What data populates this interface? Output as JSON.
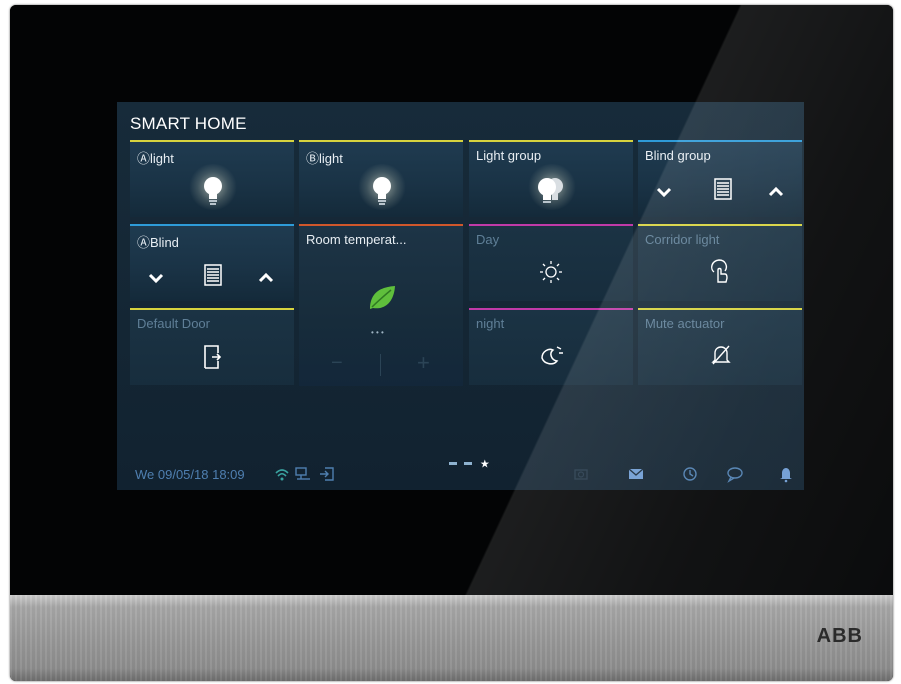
{
  "header": {
    "title": "SMART HOME"
  },
  "brand": {
    "logo_text": "ABB"
  },
  "tiles": [
    {
      "label": "Ⓐlight",
      "icon": "bulb-icon",
      "accent": "#d7d33e"
    },
    {
      "label": "Ⓑlight",
      "icon": "bulb-icon",
      "accent": "#d7d33e"
    },
    {
      "label": "Light group",
      "icon": "double-bulb-icon",
      "accent": "#d7d33e"
    },
    {
      "label": "Blind group",
      "icon": "blind-icon",
      "accent": "#2e9bd8"
    },
    {
      "label": "ⒶBlind",
      "icon": "blind-icon",
      "accent": "#2e9bd8"
    },
    {
      "label": "Room temperat...",
      "icon": "leaf-icon",
      "accent": "#d0572b",
      "minus": "−",
      "plus": "+",
      "dots": "• • •"
    },
    {
      "label": "Day",
      "icon": "sun-icon",
      "accent": "#c03aa8"
    },
    {
      "label": "Corridor light",
      "icon": "touch-bulb-icon",
      "accent": "#d7d33e"
    },
    {
      "label": "Default Door",
      "icon": "door-icon",
      "accent": "#d7d33e"
    },
    {
      "label": "night",
      "icon": "moon-icon",
      "accent": "#c03aa8"
    },
    {
      "label": "Mute actuator",
      "icon": "mute-bell-icon",
      "accent": "#d7d33e"
    }
  ],
  "status_bar": {
    "datetime": "We 09/05/18  18:09",
    "icons": [
      "wifi-icon",
      "network-icon",
      "logout-icon",
      "camera-icon",
      "mail-icon",
      "history-icon",
      "chat-icon",
      "bell-icon"
    ]
  },
  "colors": {
    "screen_bg": "#142634",
    "tile_bg": "#1d374b",
    "yellow": "#d7d33e",
    "blue": "#2e9bd8",
    "orange": "#d0572b",
    "magenta": "#c03aa8",
    "status_text": "#4f7fb0"
  }
}
